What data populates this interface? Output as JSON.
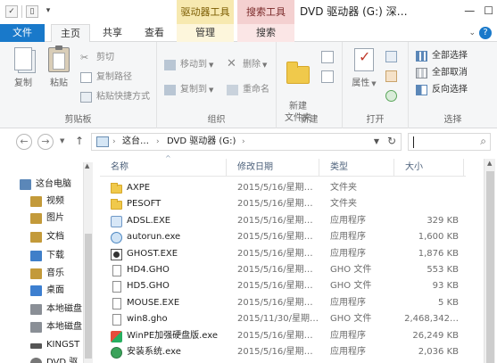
{
  "quick_access": [
    "✓",
    "▯",
    "▾"
  ],
  "context_tabs": {
    "drive_tools": "驱动器工具",
    "search_tools": "搜索工具"
  },
  "window_title": "DVD 驱动器 (G:) 深…",
  "window_buttons": {
    "minimize": "—",
    "maximize": "☐"
  },
  "tabs": {
    "file": "文件",
    "home": "主页",
    "share": "共享",
    "view": "查看",
    "manage": "管理",
    "search": "搜索"
  },
  "help": "?",
  "ribbon": {
    "clipboard": {
      "label": "剪贴板",
      "copy": "复制",
      "paste": "粘贴",
      "cut": "剪切",
      "copy_path": "复制路径",
      "paste_shortcut": "粘贴快捷方式"
    },
    "organize": {
      "label": "组织",
      "move_to": "移动到",
      "copy_to": "复制到",
      "delete": "删除",
      "rename": "重命名"
    },
    "new": {
      "label": "新建",
      "new_folder": "新建\n文件夹"
    },
    "open": {
      "label": "打开",
      "properties": "属性"
    },
    "select": {
      "label": "选择",
      "select_all": "全部选择",
      "select_none": "全部取消",
      "invert": "反向选择"
    }
  },
  "address": {
    "crumb1": "这台…",
    "crumb2": "DVD 驱动器 (G:)",
    "caret": "›"
  },
  "nav_pane": [
    {
      "label": "这台电脑",
      "color": "#5b87b8"
    },
    {
      "label": "视频",
      "color": "#c39a3a"
    },
    {
      "label": "图片",
      "color": "#c39a3a"
    },
    {
      "label": "文档",
      "color": "#c39a3a"
    },
    {
      "label": "下载",
      "color": "#3f7fc9"
    },
    {
      "label": "音乐",
      "color": "#c39a3a"
    },
    {
      "label": "桌面",
      "color": "#3d7fd0"
    },
    {
      "label": "本地磁盘",
      "color": "#8a8f96"
    },
    {
      "label": "本地磁盘",
      "color": "#8a8f96"
    },
    {
      "label": "KINGST",
      "color": "#555555"
    },
    {
      "label": "DVD 驱",
      "color": "#777777"
    }
  ],
  "columns": {
    "name": "名称",
    "date": "修改日期",
    "type": "类型",
    "size": "大小"
  },
  "files": [
    {
      "name": "AXPE",
      "date": "2015/5/16/星期…",
      "type": "文件夹",
      "size": "",
      "icon": "folder"
    },
    {
      "name": "PESOFT",
      "date": "2015/5/16/星期…",
      "type": "文件夹",
      "size": "",
      "icon": "folder"
    },
    {
      "name": "ADSL.EXE",
      "date": "2015/5/16/星期…",
      "type": "应用程序",
      "size": "329 KB",
      "icon": "exe"
    },
    {
      "name": "autorun.exe",
      "date": "2015/5/16/星期…",
      "type": "应用程序",
      "size": "1,600 KB",
      "icon": "auto"
    },
    {
      "name": "GHOST.EXE",
      "date": "2015/5/16/星期…",
      "type": "应用程序",
      "size": "1,876 KB",
      "icon": "ghost"
    },
    {
      "name": "HD4.GHO",
      "date": "2015/5/16/星期…",
      "type": "GHO 文件",
      "size": "553 KB",
      "icon": "file"
    },
    {
      "name": "HD5.GHO",
      "date": "2015/5/16/星期…",
      "type": "GHO 文件",
      "size": "93 KB",
      "icon": "file"
    },
    {
      "name": "MOUSE.EXE",
      "date": "2015/5/16/星期…",
      "type": "应用程序",
      "size": "5 KB",
      "icon": "file"
    },
    {
      "name": "win8.gho",
      "date": "2015/11/30/星期…",
      "type": "GHO 文件",
      "size": "2,468,342…",
      "icon": "file"
    },
    {
      "name": "WinPE加强硬盘版.exe",
      "date": "2015/5/16/星期…",
      "type": "应用程序",
      "size": "26,249 KB",
      "icon": "winpe"
    },
    {
      "name": "安装系统.exe",
      "date": "2015/5/16/星期…",
      "type": "应用程序",
      "size": "2,036 KB",
      "icon": "setup"
    }
  ],
  "colors": {
    "file_tab": "#1979ca",
    "ribbon_bg": "#f5f6f7",
    "drive_tools": "#f7e9b0",
    "search_tools": "#f4d0d0"
  }
}
